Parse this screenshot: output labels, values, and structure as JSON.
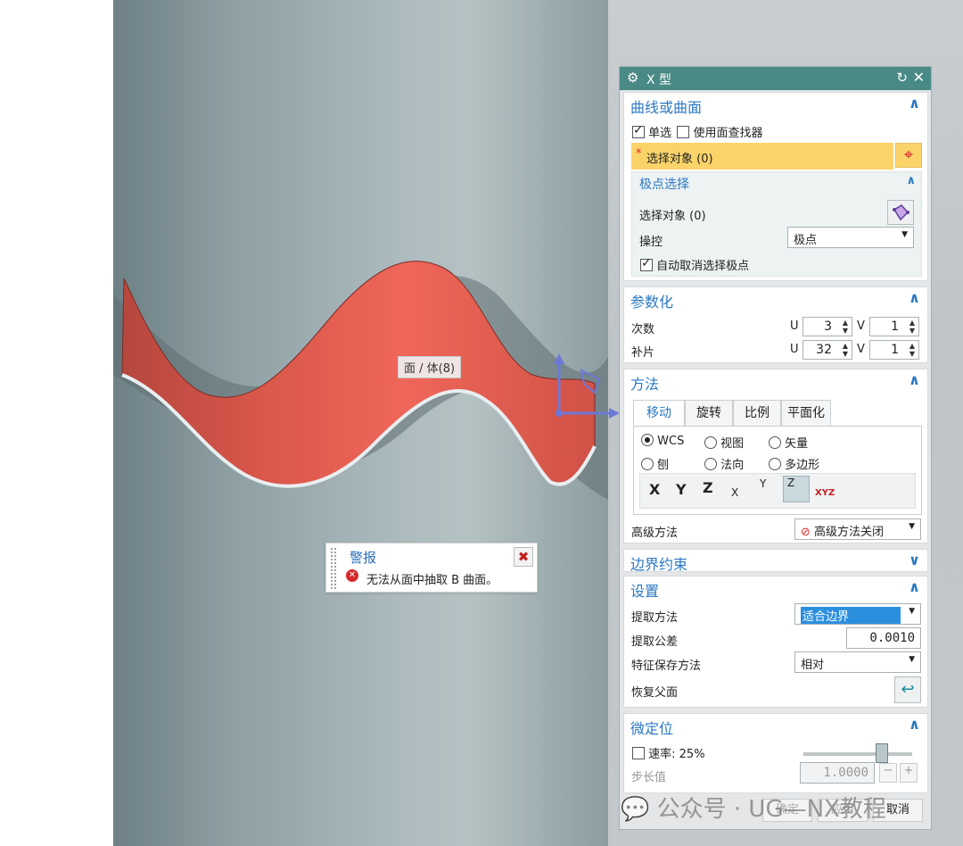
{
  "viewport": {
    "face_label": "面 / 体(8)",
    "colors": {
      "surface": "#ea5f52",
      "cylinder": "#9aacb0",
      "background": "#c4c8cb"
    }
  },
  "alert": {
    "title": "警报",
    "message": "无法从面中抽取 B 曲面。",
    "icon": "error-icon",
    "close_icon": "close-icon"
  },
  "dialog": {
    "title": "X 型",
    "curve_group": {
      "title": "曲线或曲面",
      "single_select": "单选",
      "single_checked": true,
      "face_finder": "使用面查找器",
      "face_finder_checked": false,
      "select_object": "选择对象 (0)",
      "required_mark": "*",
      "pole_select": {
        "title": "极点选择",
        "select_object": "选择对象 (0)",
        "control_label": "操控",
        "control_value": "极点",
        "auto_deselect": "自动取消选择极点",
        "auto_checked": true
      }
    },
    "param_group": {
      "title": "参数化",
      "degree_label": "次数",
      "patch_label": "补片",
      "u": "U",
      "v": "V",
      "degree_u": "3",
      "degree_v": "1",
      "patch_u": "32",
      "patch_v": "1"
    },
    "method_group": {
      "title": "方法",
      "tabs": [
        "移动",
        "旋转",
        "比例",
        "平面化"
      ],
      "active_tab": 0,
      "radios": [
        "WCS",
        "视图",
        "矢量",
        "刨",
        "法向",
        "多边形"
      ],
      "selected_radio": 0,
      "axis_buttons": [
        "X",
        "Y",
        "Z",
        "X",
        "Y",
        "Z",
        "XYZ"
      ],
      "advanced_label": "高级方法",
      "advanced_value": "高级方法关闭"
    },
    "boundary_group": {
      "title": "边界约束"
    },
    "settings_group": {
      "title": "设置",
      "extract_method_label": "提取方法",
      "extract_method_value": "适合边界",
      "tolerance_label": "提取公差",
      "tolerance_value": "0.0010",
      "preserve_label": "特征保存方法",
      "preserve_value": "相对",
      "restore_parent": "恢复父面"
    },
    "micro_group": {
      "title": "微定位",
      "rate": "速率: 25%",
      "rate_fraction": 0.7,
      "step_label": "步长值",
      "step_value": "1.0000"
    },
    "footer": {
      "ok": "确定",
      "apply": "应用",
      "cancel": "取消"
    }
  },
  "watermark": "公众号 · UG—NX教程"
}
